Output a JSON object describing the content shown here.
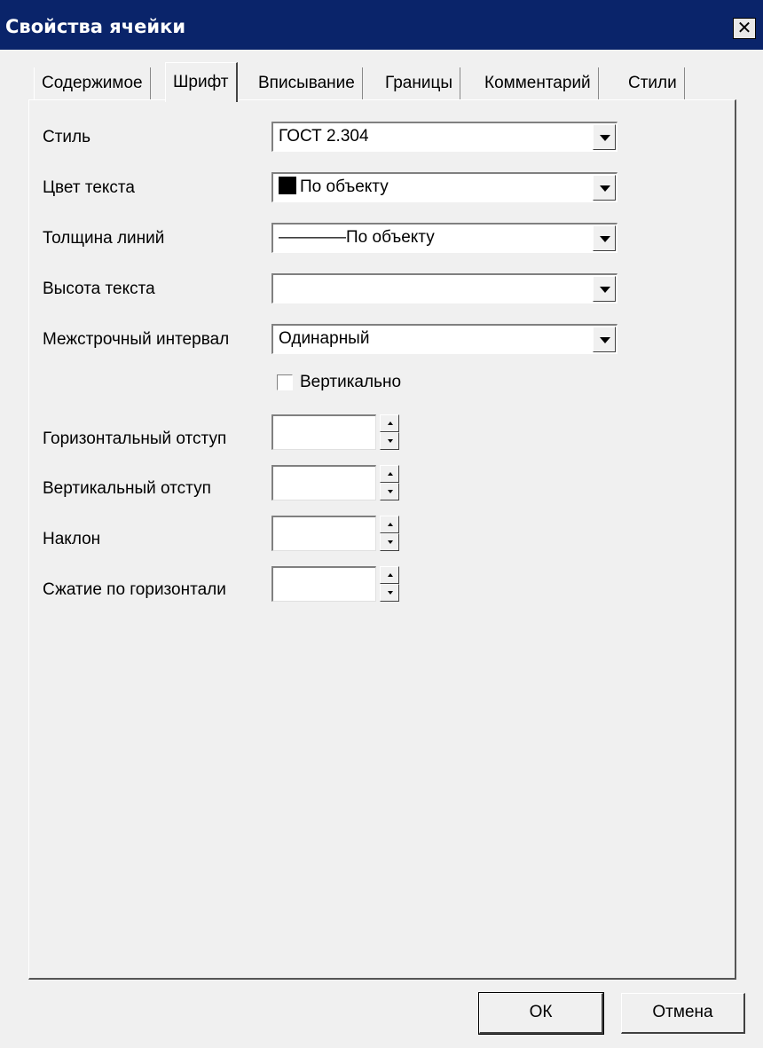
{
  "window": {
    "title": "Свойства ячейки",
    "close_glyph": "✕"
  },
  "tabs": [
    {
      "label": "Содержимое",
      "active": false
    },
    {
      "label": "Шрифт",
      "active": true
    },
    {
      "label": "Вписывание",
      "active": false
    },
    {
      "label": "Границы",
      "active": false
    },
    {
      "label": "Комментарий",
      "active": false
    },
    {
      "label": "Стили",
      "active": false
    }
  ],
  "form": {
    "style": {
      "label": "Стиль",
      "value": "ГОСТ 2.304"
    },
    "text_color": {
      "label": "Цвет текста",
      "value": "По объекту",
      "swatch_color": "#000000"
    },
    "line_weight": {
      "label": "Толщина линий",
      "line_prefix": "————",
      "value": "По объекту"
    },
    "text_height": {
      "label": "Высота текста",
      "value": ""
    },
    "line_spacing": {
      "label": "Межстрочный интервал",
      "value": "Одинарный"
    },
    "vertical": {
      "label": "Вертикально",
      "checked": false
    },
    "horizontal_indent": {
      "label": "Горизонтальный отступ",
      "value": ""
    },
    "vertical_indent": {
      "label": "Вертикальный отступ",
      "value": ""
    },
    "slant": {
      "label": "Наклон",
      "value": ""
    },
    "horizontal_compression": {
      "label": "Сжатие по горизонтали",
      "value": ""
    }
  },
  "buttons": {
    "ok": "ОК",
    "cancel": "Отмена"
  }
}
